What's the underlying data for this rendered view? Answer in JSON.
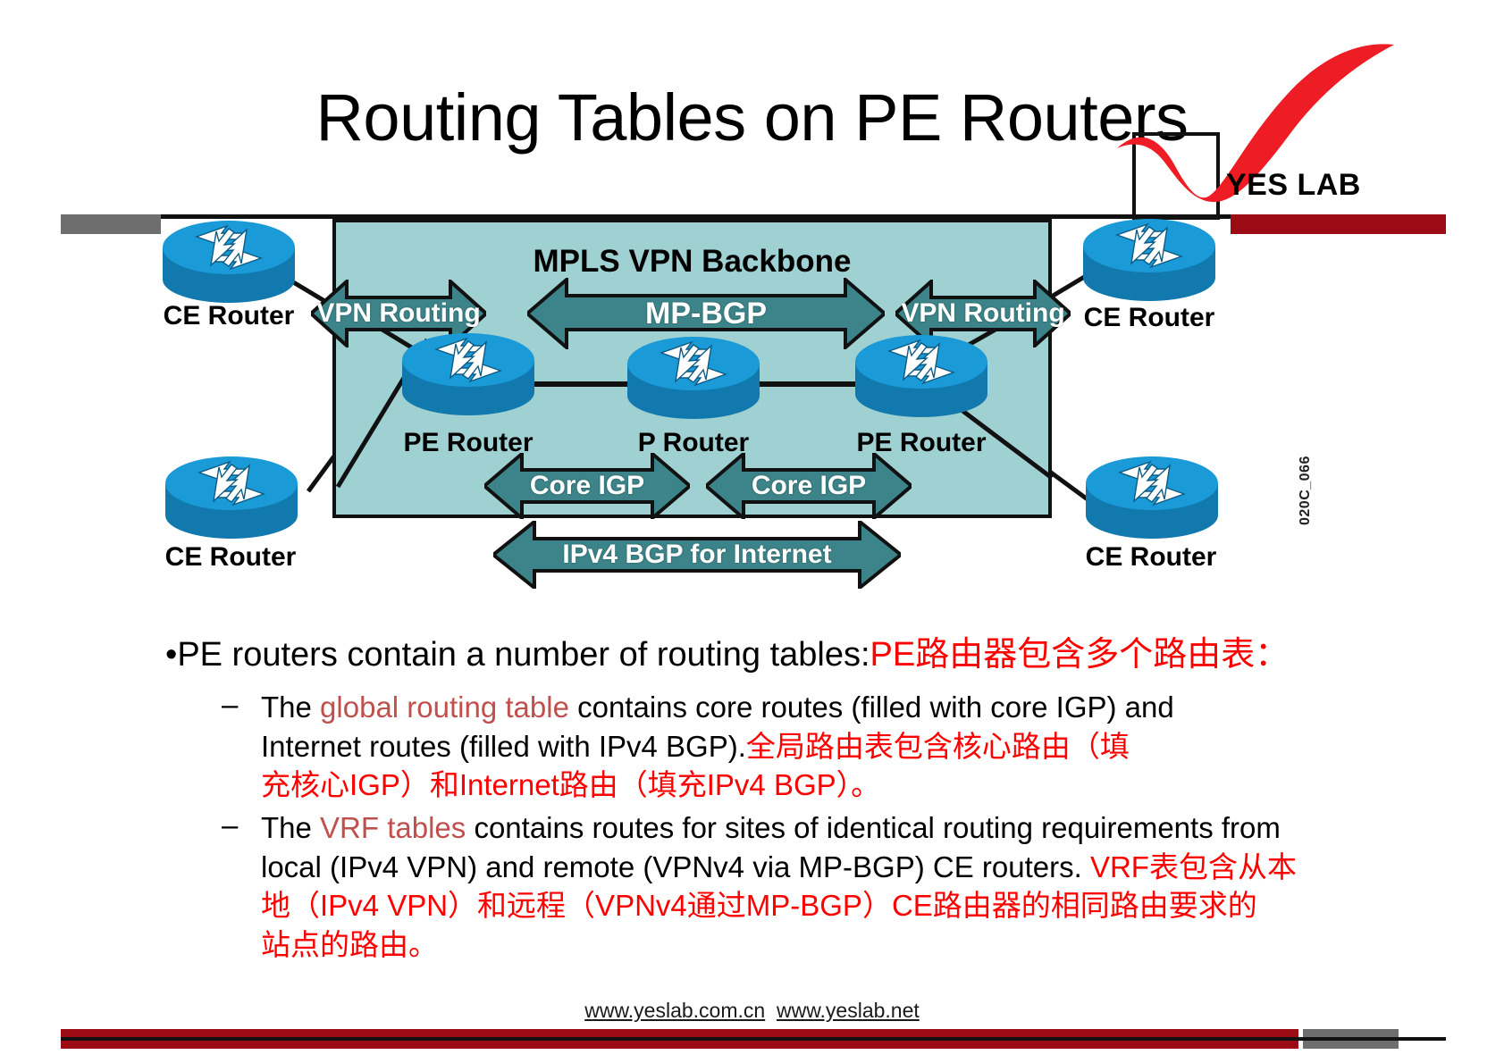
{
  "slide": {
    "title": "Routing Tables on PE Routers",
    "logo_text": "YES LAB",
    "slide_code": "020C_066"
  },
  "colors": {
    "backbone_fill": "#9fd0d2",
    "banner_fill": "#3c8489",
    "accent_red": "#ff0000",
    "accent_term": "#c0504d",
    "brand_red": "#9c0c14",
    "router_blue": "#1a9ad7",
    "router_blue_dark": "#1179ad"
  },
  "diagram": {
    "backbone_label": "MPLS VPN Backbone",
    "routers": [
      {
        "id": "ce-top-left",
        "label": "CE Router"
      },
      {
        "id": "ce-bottom-left",
        "label": "CE Router"
      },
      {
        "id": "pe-left",
        "label": "PE Router"
      },
      {
        "id": "p-center",
        "label": "P Router"
      },
      {
        "id": "pe-right",
        "label": "PE Router"
      },
      {
        "id": "ce-top-right",
        "label": "CE Router"
      },
      {
        "id": "ce-bottom-right",
        "label": "CE Router"
      }
    ],
    "banners": [
      {
        "id": "vpn-routing-left",
        "label": "VPN Routing"
      },
      {
        "id": "mp-bgp",
        "label": "MP-BGP"
      },
      {
        "id": "vpn-routing-right",
        "label": "VPN Routing"
      },
      {
        "id": "core-igp-left",
        "label": "Core IGP"
      },
      {
        "id": "core-igp-right",
        "label": "Core IGP"
      },
      {
        "id": "ipv4-bgp-internet",
        "label": "IPv4 BGP for Internet"
      }
    ]
  },
  "content": {
    "bullet_marker": "•",
    "dash_marker": "–",
    "bullet1": {
      "en": "PE routers contain a number of routing tables:",
      "cn": "PE路由器包含多个路由表："
    },
    "sub1": {
      "line1_a": "The ",
      "line1_term": "global routing table",
      "line1_b": " contains core routes (filled  with core IGP) and",
      "line2_a": "Internet routes (filled  with IPv4 BGP).",
      "line2_cn": "全局路由表包含核心路由（填",
      "line3_cn": "充核心IGP）和Internet路由（填充IPv4 BGP）。"
    },
    "sub2": {
      "line1_a": "The ",
      "line1_term": "VRF tables",
      "line1_b": " contains routes for sites of identical  routing requirements  from",
      "line2_a": "local (IPv4 VPN) and remote (VPNv4 via MP-BGP) CE routers. ",
      "line2_cn": "VRF表包含从本",
      "line3_cn": "地（IPv4 VPN）和远程（VPNv4通过MP-BGP）CE路由器的相同路由要求的",
      "line4_cn": "站点的路由。"
    }
  },
  "footer": {
    "url1": "www.yeslab.com.cn",
    "url2": "www.yeslab.net"
  }
}
